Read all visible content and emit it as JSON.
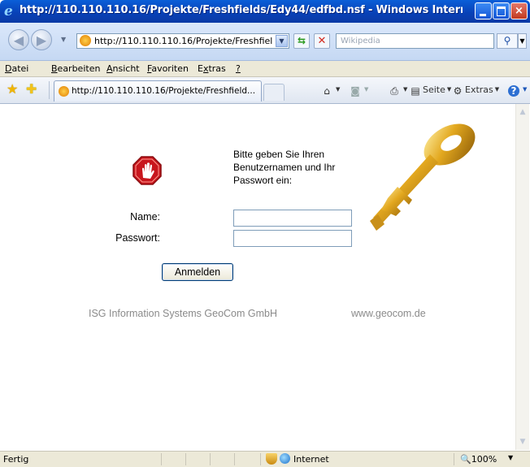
{
  "window": {
    "title": "http://110.110.110.16/Projekte/Freshfields/Edy44/edfbd.nsf - Windows Internet Exp...",
    "min_label": "",
    "max_label": "",
    "close_label": "×"
  },
  "address_bar": {
    "url": "http://110.110.110.16/Projekte/Freshfields/E",
    "back_glyph": "◀",
    "forward_glyph": "▶",
    "refresh_glyph": "⇆",
    "stop_glyph": "✕",
    "search_placeholder": "Wikipedia",
    "search_glyph": "⚲"
  },
  "menu": {
    "items": [
      {
        "mnemonic": "D",
        "rest": "atei"
      },
      {
        "mnemonic": "B",
        "rest": "earbeiten"
      },
      {
        "mnemonic": "A",
        "rest": "nsicht"
      },
      {
        "mnemonic": "F",
        "rest": "avoriten"
      },
      {
        "pre": "E",
        "mnemonic": "x",
        "rest": "tras"
      },
      {
        "mnemonic": "?",
        "rest": ""
      }
    ]
  },
  "toolbar": {
    "favorites_icon": "star-icon",
    "add_favorites_icon": "add-favorite-icon",
    "tab_title": "http://110.110.110.16/Projekte/Freshfield...",
    "home_glyph": "⌂",
    "feeds_glyph": "◙",
    "print_glyph": "⎙",
    "page_label": "Seite",
    "page_mnemonic": "i",
    "tools_label": "Extras",
    "help_glyph": "?"
  },
  "login": {
    "prompt": "Bitte geben Sie Ihren Benutzernamen und Ihr Passwort ein:",
    "name_label": "Name:",
    "password_label": "Passwort:",
    "name_value": "",
    "password_value": "",
    "submit_label": "Anmelden"
  },
  "footer": {
    "company": "ISG Information Systems GeoCom GmbH",
    "website": "www.geocom.de"
  },
  "status": {
    "text": "Fertig",
    "zone": "Internet",
    "zoom": "100%"
  }
}
